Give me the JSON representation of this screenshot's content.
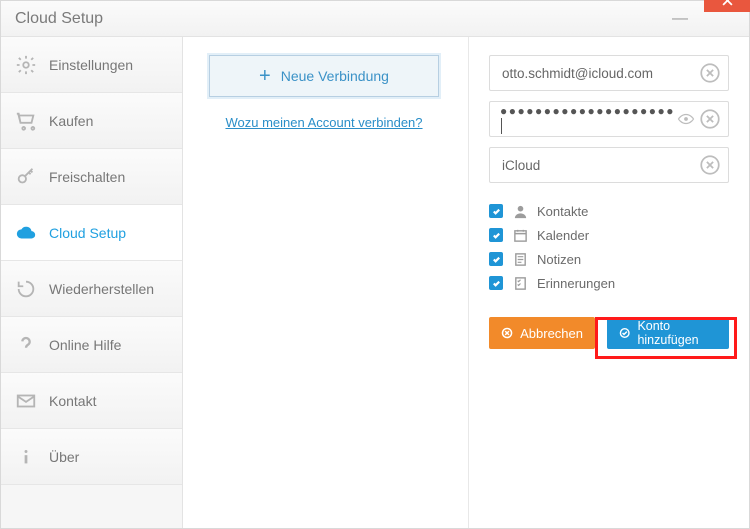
{
  "window": {
    "title": "Cloud Setup"
  },
  "sidebar": {
    "items": [
      {
        "label": "Einstellungen"
      },
      {
        "label": "Kaufen"
      },
      {
        "label": "Freischalten"
      },
      {
        "label": "Cloud Setup"
      },
      {
        "label": "Wiederherstellen"
      },
      {
        "label": "Online Hilfe"
      },
      {
        "label": "Kontakt"
      },
      {
        "label": "Über"
      }
    ]
  },
  "center": {
    "new_connection": "Neue Verbindung",
    "help_link": "Wozu meinen Account verbinden?"
  },
  "form": {
    "email": "otto.schmidt@icloud.com",
    "password_mask": "●●●●●●●●●●●●●●●●●●●●",
    "service": "iCloud",
    "options": {
      "contacts": "Kontakte",
      "calendar": "Kalender",
      "notes": "Notizen",
      "reminders": "Erinnerungen"
    },
    "cancel": "Abbrechen",
    "add": "Konto hinzufügen"
  }
}
